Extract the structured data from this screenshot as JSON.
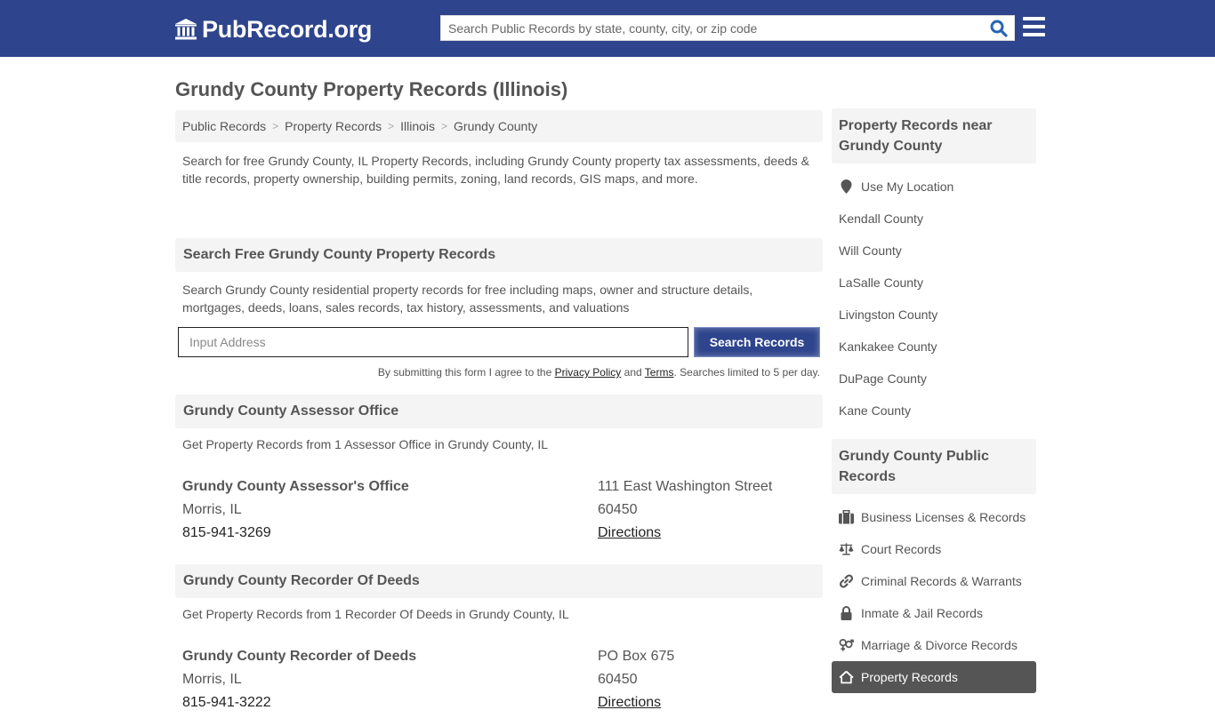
{
  "header": {
    "logo_text": "PubRecord.org",
    "search_placeholder": "Search Public Records by state, county, city, or zip code"
  },
  "page_title": "Grundy County Property Records (Illinois)",
  "breadcrumb": [
    "Public Records",
    "Property Records",
    "Illinois",
    "Grundy County"
  ],
  "intro": "Search for free Grundy County, IL Property Records, including Grundy County property tax assessments, deeds & title records, property ownership, building permits, zoning, land records, GIS maps, and more.",
  "search_section": {
    "title": "Search Free Grundy County Property Records",
    "description": "Search Grundy County residential property records for free including maps, owner and structure details, mortgages, deeds, loans, sales records, tax history, assessments, and valuations",
    "input_placeholder": "Input Address",
    "button_label": "Search Records",
    "disclaimer_prefix": "By submitting this form I agree to the ",
    "privacy_link": "Privacy Policy",
    "and_text": " and ",
    "terms_link": "Terms",
    "disclaimer_suffix": ". Searches limited to 5 per day."
  },
  "offices": [
    {
      "section_title": "Grundy County Assessor Office",
      "section_desc": "Get Property Records from 1 Assessor Office in Grundy County, IL",
      "name": "Grundy County Assessor's Office",
      "city": "Morris, IL",
      "phone": "815-941-3269",
      "address": "111 East Washington Street",
      "zip": "60450",
      "directions": "Directions"
    },
    {
      "section_title": "Grundy County Recorder Of Deeds",
      "section_desc": "Get Property Records from 1 Recorder Of Deeds in Grundy County, IL",
      "name": "Grundy County Recorder of Deeds",
      "city": "Morris, IL",
      "phone": "815-941-3222",
      "address": "PO Box 675",
      "zip": "60450",
      "directions": "Directions"
    }
  ],
  "sidebar": {
    "nearby_title": "Property Records near Grundy County",
    "use_location": "Use My Location",
    "nearby": [
      "Kendall County",
      "Will County",
      "LaSalle County",
      "Livingston County",
      "Kankakee County",
      "DuPage County",
      "Kane County"
    ],
    "public_title": "Grundy County Public Records",
    "public_records": [
      {
        "label": "Business Licenses & Records",
        "icon": "briefcase-icon"
      },
      {
        "label": "Court Records",
        "icon": "scale-icon"
      },
      {
        "label": "Criminal Records & Warrants",
        "icon": "link-icon"
      },
      {
        "label": "Inmate & Jail Records",
        "icon": "lock-icon"
      },
      {
        "label": "Marriage & Divorce Records",
        "icon": "gender-icon"
      },
      {
        "label": "Property Records",
        "icon": "home-icon",
        "active": true
      }
    ]
  }
}
